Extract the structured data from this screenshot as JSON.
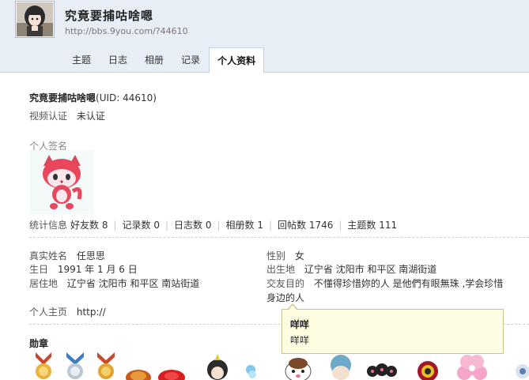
{
  "header": {
    "title": "究竟要捕咕啥嗯",
    "url": "http://bbs.9you.com/?44610"
  },
  "tabs": [
    {
      "label": "主题"
    },
    {
      "label": "日志"
    },
    {
      "label": "相册"
    },
    {
      "label": "记录"
    },
    {
      "label": "个人资料"
    }
  ],
  "active_tab": "个人资料",
  "profile": {
    "username": "究竟要捕咕啥嗯",
    "uid": "(UID: 44610)",
    "video_verify_label": "视频认证",
    "video_verify_value": "未认证",
    "signature_label": "个人签名"
  },
  "stats": {
    "label": "统计信息",
    "friends": "好友数 8",
    "records": "记录数 0",
    "blogs": "日志数 0",
    "albums": "相册数 1",
    "replies": "回帖数 1746",
    "topics": "主题数 111"
  },
  "details": {
    "realname_label": "真实姓名",
    "realname_value": "任思思",
    "gender_label": "性别",
    "gender_value": "女",
    "birthday_label": "生日",
    "birthday_value": "1991 年 1 月 6 日",
    "birthplace_label": "出生地",
    "birthplace_value": "辽宁省 沈阳市 和平区 南湖街道",
    "residence_label": "居住地",
    "residence_value": "辽宁省 沈阳市 和平区 南站街道",
    "purpose_label": "交友目的",
    "purpose_value_line1": "不懂得珍惜妳的人 是他們有眼無珠 ,学会珍惜",
    "purpose_value_line2": "身边的人",
    "homepage_label": "个人主页",
    "homepage_value": "http://"
  },
  "medals": {
    "label": "勋章"
  },
  "tooltip": {
    "title": "咩咩",
    "body": "咩咩"
  },
  "colors": {
    "header_bg": "#e8eef5",
    "border": "#c2d5e3",
    "tooltip_bg": "#fefde2"
  }
}
